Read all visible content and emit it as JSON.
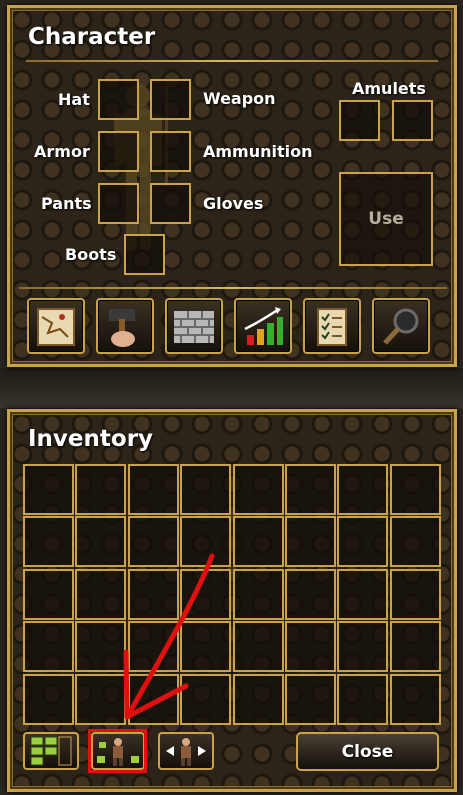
{
  "character": {
    "title": "Character",
    "labels": {
      "hat": "Hat",
      "weapon": "Weapon",
      "armor": "Armor",
      "ammunition": "Ammunition",
      "pants": "Pants",
      "gloves": "Gloves",
      "boots": "Boots",
      "amulets": "Amulets"
    },
    "use_label": "Use",
    "toolbar_icons": [
      "map-scroll-icon",
      "hammer-hand-icon",
      "brick-wall-icon",
      "stats-chart-icon",
      "quest-list-icon",
      "magnifier-icon"
    ]
  },
  "inventory": {
    "title": "Inventory",
    "grid": {
      "rows": 5,
      "columns": 8
    },
    "bottom_buttons": [
      "grid-view-icon",
      "character-move-icon",
      "character-drag-icon"
    ],
    "close_label": "Close"
  },
  "annotation": {
    "highlight_color": "#e01010",
    "arrow_color": "#e01010"
  },
  "colors": {
    "frame_gold": "#c9a24a",
    "panel_dark": "#2c2419"
  }
}
